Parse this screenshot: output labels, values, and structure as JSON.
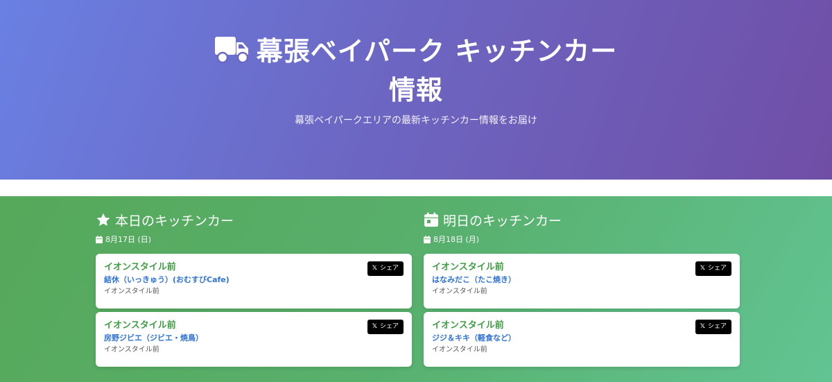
{
  "hero": {
    "title_line1": "幕張ベイパーク キッチンカー",
    "title_line2": "情報",
    "icon": "truck-icon",
    "subtitle": "幕張ベイパークエリアの最新キッチンカー情報をお届け"
  },
  "today": {
    "icon": "star-icon",
    "heading": "本日のキッチンカー",
    "date": "8月17日 (日)",
    "cards": [
      {
        "location": "イオンスタイル前",
        "vendor": "結休（いっきゅう）(おむすびCafe)",
        "place": "イオンスタイル前",
        "share_label": "シェア",
        "share_logo": "𝕏"
      },
      {
        "location": "イオンスタイル前",
        "vendor": "房野ジビエ（ジビエ・焼鳥）",
        "place": "イオンスタイル前",
        "share_label": "シェア",
        "share_logo": "𝕏"
      }
    ]
  },
  "tomorrow": {
    "icon": "calendar-icon",
    "heading": "明日のキッチンカー",
    "date": "8月18日 (月)",
    "cards": [
      {
        "location": "イオンスタイル前",
        "vendor": "はなみだこ（たこ焼き）",
        "place": "イオンスタイル前",
        "share_label": "シェア",
        "share_logo": "𝕏"
      },
      {
        "location": "イオンスタイル前",
        "vendor": "ジジ＆キキ（軽食など）",
        "place": "イオンスタイル前",
        "share_label": "シェア",
        "share_logo": "𝕏"
      }
    ]
  },
  "colors": {
    "hero_start": "#6a80e3",
    "hero_end": "#704ea6",
    "main_start": "#56a85a",
    "main_end": "#62c493",
    "location_text": "#3f9e44",
    "vendor_text": "#2f73d6",
    "share_bg": "#000000"
  }
}
